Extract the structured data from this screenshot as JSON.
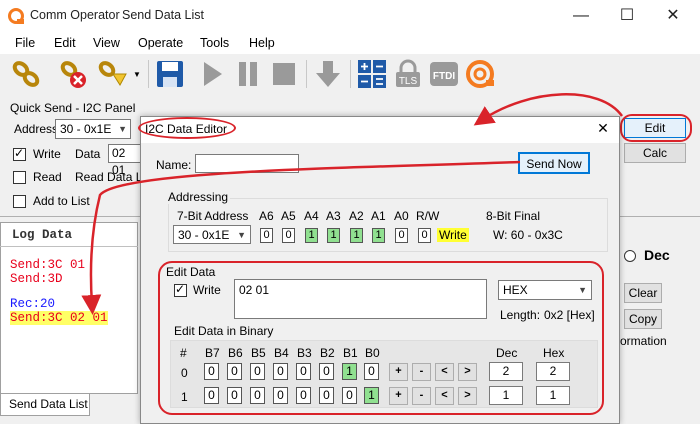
{
  "window": {
    "app_title": "Comm Operator",
    "doc_title": "Send Data List",
    "minimize": "—",
    "maximize": "☐",
    "close": "✕"
  },
  "menu": [
    "File",
    "Edit",
    "View",
    "Operate",
    "Tools",
    "Help"
  ],
  "toolbar": {
    "tls_label": "TLS",
    "ftdi_label": "FTDI"
  },
  "quick_send": {
    "title": "Quick Send - I2C Panel",
    "address_label": "Address",
    "address_value": "30 - 0x1E",
    "write_label": "Write",
    "data_label": "Data",
    "data_value": "02 01",
    "read_label": "Read",
    "read_data_len_label": "Read Data Le",
    "add_to_list_label": "Add to List",
    "edit_button": "Edit",
    "calc_button": "Calc"
  },
  "log": {
    "title": "Log Data",
    "lines": [
      {
        "text": "Send:3C 01",
        "color": "#e8001c",
        "hl": false
      },
      {
        "text": "Send:3D",
        "color": "#e8001c",
        "hl": false
      },
      {
        "text": "",
        "color": "#000",
        "hl": false
      },
      {
        "text": "Rec:20",
        "color": "#1a1aff",
        "hl": false
      },
      {
        "text": "Send:3C 02 01",
        "color": "#e8001c",
        "hl": true
      }
    ],
    "tab_label": "Send Data List"
  },
  "right_panel": {
    "dec_label": "Dec",
    "clear_button": "Clear",
    "copy_button": "Copy",
    "formation_text": "ormation"
  },
  "dialog": {
    "title": "I2C Data Editor",
    "close": "✕",
    "name_label": "Name:",
    "name_value": "",
    "send_now_button": "Send Now",
    "addressing": {
      "title": "Addressing",
      "seven_bit_label": "7-Bit Address",
      "address_value": "30 - 0x1E",
      "bit_headers": [
        "A6",
        "A5",
        "A4",
        "A3",
        "A2",
        "A1",
        "A0",
        "R/W"
      ],
      "bits": [
        "0",
        "0",
        "1",
        "1",
        "1",
        "1",
        "0",
        "0"
      ],
      "rw_value": "Write",
      "eight_bit_label": "8-Bit Final",
      "eight_bit_value": "W: 60 - 0x3C"
    },
    "edit_data": {
      "title": "Edit Data",
      "write_label": "Write",
      "data_value": "02 01",
      "format_value": "HEX",
      "length_label": "Length:",
      "length_value": "0x2 [Hex]",
      "binary_title": "Edit Data in Binary",
      "col_headers": [
        "#",
        "B7",
        "B6",
        "B5",
        "B4",
        "B3",
        "B2",
        "B1",
        "B0",
        "Dec",
        "Hex"
      ],
      "rows": [
        {
          "index": "0",
          "bits": [
            "0",
            "0",
            "0",
            "0",
            "0",
            "0",
            "1",
            "0"
          ],
          "dec": "2",
          "hex": "2"
        },
        {
          "index": "1",
          "bits": [
            "0",
            "0",
            "0",
            "0",
            "0",
            "0",
            "0",
            "1"
          ],
          "dec": "1",
          "hex": "1"
        }
      ],
      "op_buttons": [
        "+",
        "-",
        "<",
        ">"
      ]
    }
  }
}
